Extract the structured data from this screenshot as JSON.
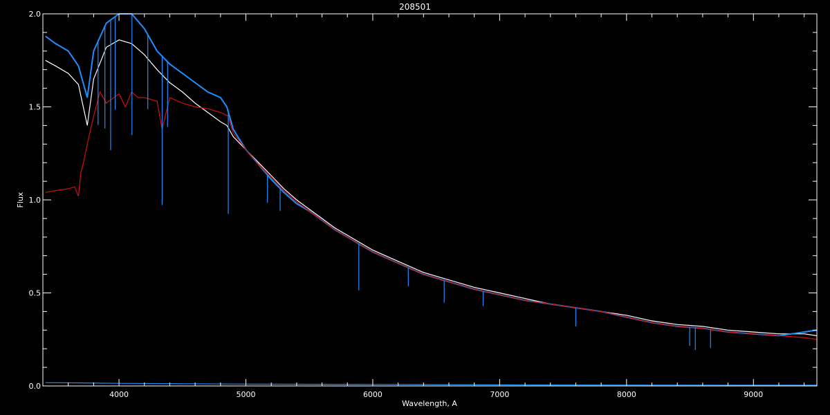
{
  "chart_data": {
    "type": "line",
    "title": "208501",
    "xlabel": "Wavelength, A",
    "ylabel": "Flux",
    "xlim": [
      3400,
      9500
    ],
    "ylim": [
      0.0,
      2.0
    ],
    "x_ticks": [
      4000,
      5000,
      6000,
      7000,
      8000,
      9000
    ],
    "y_ticks": [
      0.0,
      0.5,
      1.0,
      1.5,
      2.0
    ],
    "y_tick_labels": [
      "0.0",
      "0.5",
      "1.0",
      "1.5",
      "2.0"
    ],
    "grid": false,
    "background": "#000000",
    "axis_color": "#ffffff",
    "series": [
      {
        "color": "#ffffff",
        "x": [
          3420,
          3500,
          3600,
          3680,
          3750,
          3800,
          3900,
          4000,
          4100,
          4200,
          4300,
          4400,
          4500,
          4600,
          4700,
          4800,
          4850,
          4900,
          5000,
          5100,
          5200,
          5300,
          5400,
          5500,
          5600,
          5700,
          5800,
          5900,
          6000,
          6200,
          6400,
          6600,
          6800,
          7000,
          7200,
          7400,
          7600,
          7800,
          8000,
          8200,
          8400,
          8600,
          8800,
          9000,
          9200,
          9400,
          9500
        ],
        "y": [
          1.75,
          1.72,
          1.68,
          1.62,
          1.4,
          1.65,
          1.82,
          1.86,
          1.84,
          1.78,
          1.7,
          1.63,
          1.58,
          1.52,
          1.47,
          1.42,
          1.4,
          1.34,
          1.27,
          1.2,
          1.13,
          1.06,
          1.0,
          0.95,
          0.9,
          0.85,
          0.81,
          0.77,
          0.73,
          0.67,
          0.61,
          0.57,
          0.53,
          0.5,
          0.47,
          0.44,
          0.42,
          0.4,
          0.38,
          0.35,
          0.33,
          0.32,
          0.3,
          0.29,
          0.28,
          0.28,
          0.27
        ]
      },
      {
        "color": "#1e8fff",
        "x": [
          3420,
          3500,
          3600,
          3680,
          3750,
          3800,
          3900,
          4000,
          4100,
          4200,
          4300,
          4400,
          4500,
          4600,
          4700,
          4800,
          4850,
          4900,
          5000,
          5100,
          5200,
          5300,
          5400,
          5500,
          5600,
          5700,
          5800,
          5900,
          6000,
          6200,
          6400,
          6600,
          6800,
          7000,
          7200,
          7400,
          7600,
          7800,
          8000,
          8200,
          8400,
          8600,
          8800,
          9000,
          9200,
          9400,
          9500
        ],
        "y": [
          1.88,
          1.84,
          1.8,
          1.72,
          1.55,
          1.8,
          1.95,
          2.0,
          2.0,
          1.92,
          1.8,
          1.73,
          1.68,
          1.63,
          1.58,
          1.55,
          1.5,
          1.38,
          1.27,
          1.19,
          1.11,
          1.04,
          0.98,
          0.94,
          0.89,
          0.84,
          0.8,
          0.76,
          0.72,
          0.66,
          0.6,
          0.56,
          0.52,
          0.49,
          0.46,
          0.44,
          0.42,
          0.4,
          0.37,
          0.34,
          0.32,
          0.31,
          0.29,
          0.28,
          0.27,
          0.29,
          0.3
        ]
      },
      {
        "color": "#d01010",
        "x": [
          3420,
          3500,
          3600,
          3650,
          3680,
          3700,
          3720,
          3750,
          3800,
          3850,
          3900,
          4000,
          4050,
          4100,
          4150,
          4200,
          4300,
          4340,
          4400,
          4500,
          4600,
          4700,
          4800,
          4860,
          4900,
          5000,
          5100,
          5200,
          5300,
          5400,
          5500,
          5600,
          5700,
          5800,
          5900,
          6000,
          6200,
          6400,
          6600,
          6800,
          7000,
          7200,
          7400,
          7600,
          7800,
          8000,
          8200,
          8400,
          8600,
          8800,
          9000,
          9200,
          9400,
          9500
        ],
        "y": [
          1.04,
          1.05,
          1.06,
          1.07,
          1.02,
          1.15,
          1.2,
          1.3,
          1.45,
          1.58,
          1.52,
          1.57,
          1.5,
          1.58,
          1.55,
          1.55,
          1.53,
          1.38,
          1.55,
          1.52,
          1.5,
          1.49,
          1.47,
          1.45,
          1.36,
          1.27,
          1.19,
          1.12,
          1.05,
          0.99,
          0.94,
          0.89,
          0.84,
          0.8,
          0.76,
          0.72,
          0.66,
          0.6,
          0.56,
          0.52,
          0.49,
          0.46,
          0.44,
          0.42,
          0.4,
          0.37,
          0.34,
          0.32,
          0.31,
          0.29,
          0.28,
          0.27,
          0.26,
          0.25
        ]
      },
      {
        "color": "#1e8fff",
        "x": [
          3420,
          4000,
          5000,
          6000,
          7000,
          8000,
          9000,
          9500
        ],
        "y": [
          0.018,
          0.014,
          0.01,
          0.008,
          0.006,
          0.005,
          0.004,
          0.004
        ]
      }
    ],
    "absorption_lines": {
      "x": [
        3835,
        3889,
        3934,
        3970,
        4102,
        4227,
        4340,
        4383,
        4861,
        5170,
        5270,
        5890,
        6280,
        6563,
        6870,
        7600,
        8498,
        8542,
        8662
      ],
      "depth": [
        0.45,
        0.55,
        0.7,
        0.5,
        0.65,
        0.4,
        0.8,
        0.35,
        0.55,
        0.15,
        0.12,
        0.25,
        0.1,
        0.12,
        0.08,
        0.1,
        0.1,
        0.12,
        0.1
      ]
    }
  }
}
